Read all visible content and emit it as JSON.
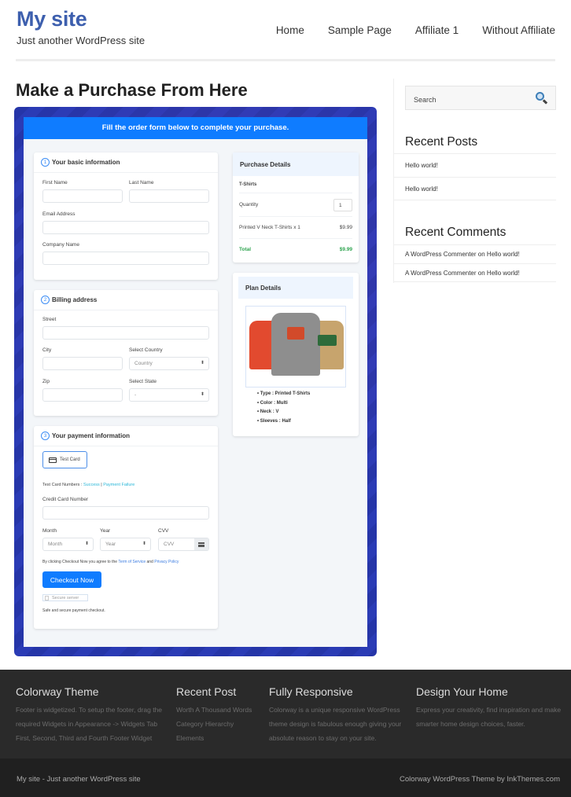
{
  "header": {
    "site_title": "My site",
    "tagline": "Just another WordPress site",
    "nav": [
      "Home",
      "Sample Page",
      "Affiliate 1",
      "Without Affiliate"
    ]
  },
  "page_title": "Make a Purchase From Here",
  "form": {
    "banner": "Fill the order form below to complete your purchase.",
    "basic": {
      "step": "1",
      "title": "Your basic information",
      "first_name": "First Name",
      "last_name": "Last Name",
      "email": "Email Address",
      "company": "Company Name"
    },
    "billing": {
      "step": "2",
      "title": "Billing address",
      "street": "Street",
      "city": "City",
      "country_label": "Select Country",
      "country_value": "Country",
      "zip": "Zip",
      "state_label": "Select State",
      "state_value": "-"
    },
    "payment": {
      "step": "3",
      "title": "Your payment information",
      "method": "Test Card",
      "test_numbers_label": "Test Card Numbers :",
      "success": "Success",
      "separator": "|",
      "failure": "Payment Failure",
      "cc_label": "Credit Card Number",
      "month_label": "Month",
      "month_value": "Month",
      "year_label": "Year",
      "year_value": "Year",
      "cvv_label": "CVV",
      "cvv_placeholder": "CVV",
      "terms_prefix": "By clicking Checkout Now you agree to the",
      "terms_link": "Term of Service",
      "and": "and",
      "privacy_link": "Privacy Policy",
      "checkout": "Checkout Now",
      "secure": "Secure server",
      "safe": "Safe and secure payment checkout."
    },
    "purchase": {
      "title": "Purchase Details",
      "product_group": "T-Shirts",
      "quantity_label": "Quantity",
      "quantity_value": "1",
      "item": "Printed V Neck T-Shirts x 1",
      "item_price": "$9.99",
      "total_label": "Total",
      "total_value": "$9.99"
    },
    "plan": {
      "title": "Plan Details",
      "specs": [
        "Type : Printed T-Shirts",
        "Color : Multi",
        "Neck : V",
        "Sleeves : Half"
      ]
    }
  },
  "sidebar": {
    "search_placeholder": "Search",
    "recent_posts_title": "Recent Posts",
    "recent_posts": [
      "Hello world!",
      "Hello world!"
    ],
    "recent_comments_title": "Recent Comments",
    "recent_comments": [
      {
        "author": "A WordPress Commenter",
        "on": "on",
        "post": "Hello world!"
      },
      {
        "author": "A WordPress Commenter",
        "on": "on",
        "post": "Hello world!"
      }
    ]
  },
  "footer": {
    "cols": [
      {
        "title": "Colorway Theme",
        "lines": [
          "Footer is widgetized. To setup the footer, drag the",
          "required Widgets in Appearance -> Widgets Tab",
          "First, Second, Third and Fourth Footer Widget"
        ]
      },
      {
        "title": "Recent Post",
        "lines": [
          "Worth A Thousand Words",
          "Category Hierarchy",
          "Elements"
        ]
      },
      {
        "title": "Fully Responsive",
        "lines": [
          "Colorway is a unique responsive WordPress",
          "theme design is fabulous enough giving your",
          "absolute reason to stay on your site."
        ]
      },
      {
        "title": "Design Your Home",
        "lines": [
          "Express your creativity, find inspiration and make",
          "smarter home design choices, faster."
        ]
      }
    ],
    "copyright": "My site - Just another WordPress site",
    "credit": "Colorway WordPress Theme by InkThemes.com"
  }
}
